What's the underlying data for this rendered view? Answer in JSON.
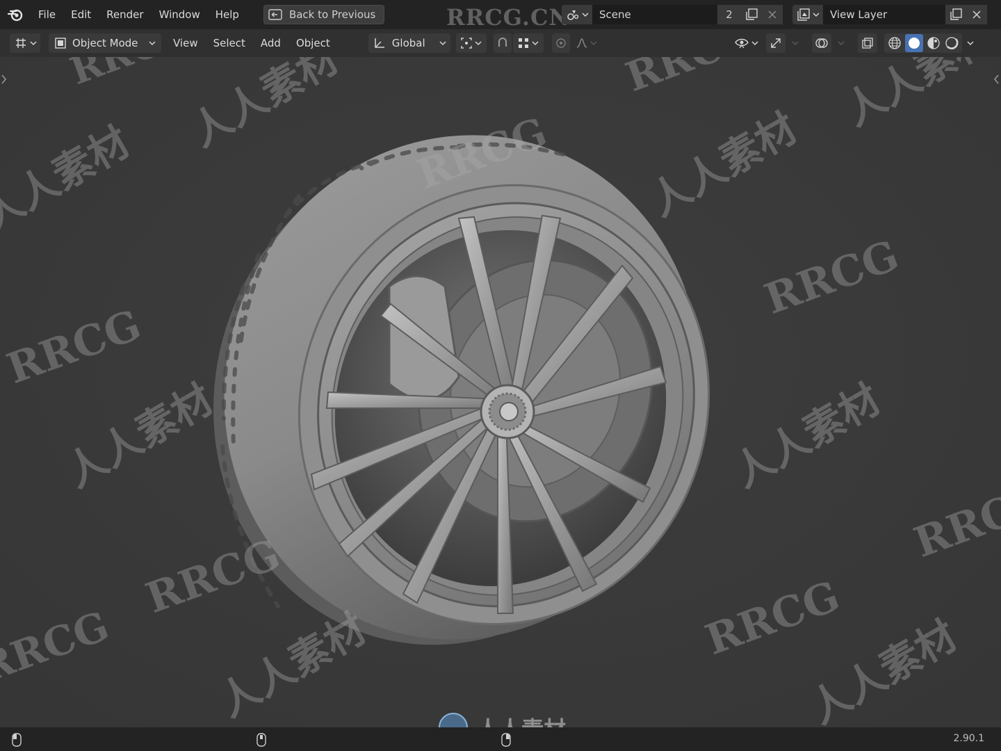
{
  "menu": {
    "file": "File",
    "edit": "Edit",
    "render": "Render",
    "window": "Window",
    "help": "Help",
    "back_to_previous": "Back to Previous"
  },
  "watermark_title": "RRCG.CN",
  "scene": {
    "name": "Scene",
    "users": "2"
  },
  "view_layer": {
    "name": "View Layer"
  },
  "header": {
    "mode": "Object Mode",
    "view": "View",
    "select": "Select",
    "add": "Add",
    "object": "Object",
    "transform_orientation": "Global"
  },
  "viewport": {
    "watermarks": [
      "RRCG",
      "人人素材"
    ],
    "bottom_logo_text": "人人素材"
  },
  "statusbar": {
    "version": "2.90.1"
  },
  "colors": {
    "topbar": "#232323",
    "header": "#303030",
    "viewport_bg": "#3a3a3a",
    "active_shading": "#ffffff",
    "accent": "#4772b3"
  },
  "icons": [
    "blender-logo-icon",
    "back-arrow-icon",
    "scene-icon",
    "duplicate-icon",
    "close-icon",
    "view-layer-icon",
    "editor-type-icon",
    "object-mode-icon",
    "transform-orientation-icon",
    "pivot-icon",
    "snap-icon",
    "snap-grid-icon",
    "proportional-edit-icon",
    "falloff-icon",
    "visibility-icon",
    "gizmo-icon",
    "overlay-icon",
    "xray-icon",
    "wireframe-shading-icon",
    "solid-shading-icon",
    "material-shading-icon",
    "rendered-shading-icon",
    "mouse-icon"
  ]
}
